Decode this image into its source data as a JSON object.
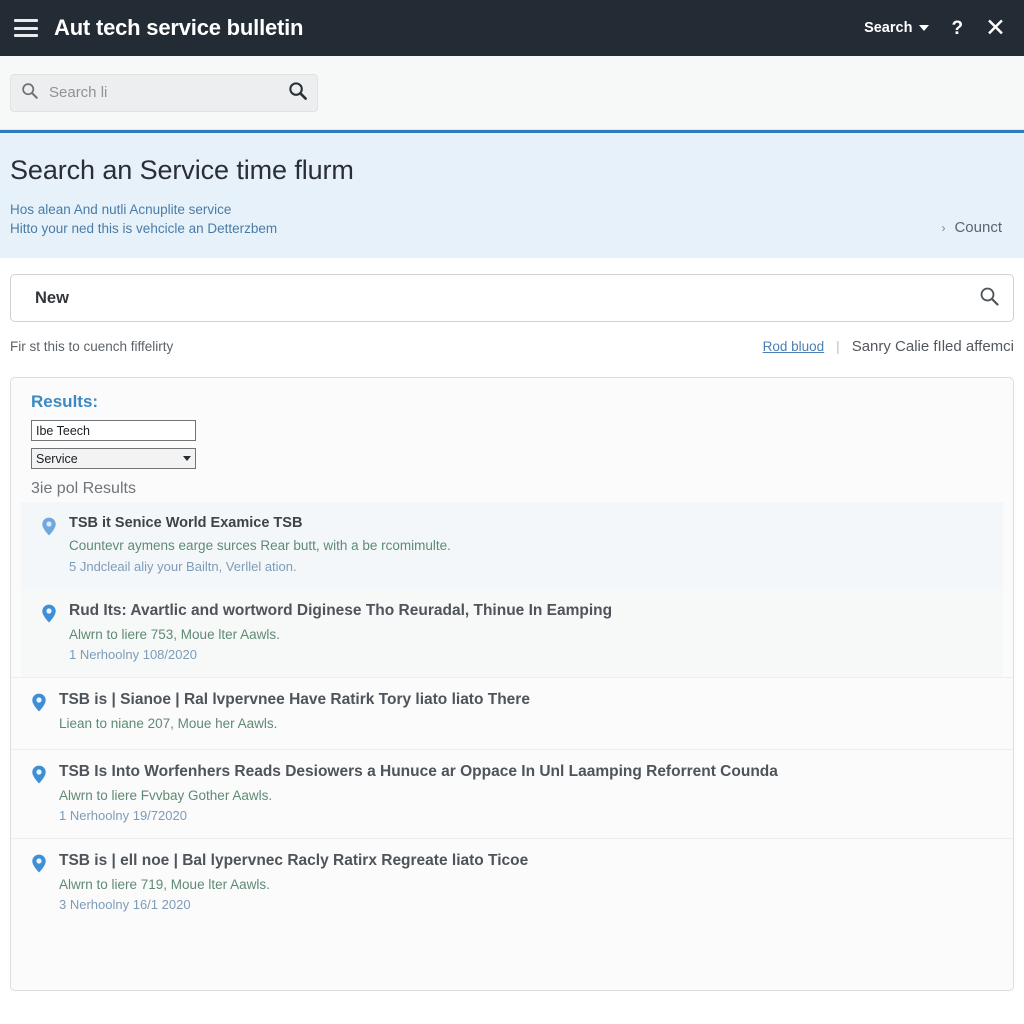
{
  "topbar": {
    "menu_icon": "hamburger-icon",
    "title": "Aut tech service bulletin",
    "search_menu_label": "Search",
    "help_label": "?",
    "close_label": "✕"
  },
  "quick_search": {
    "placeholder": "Search li",
    "value": "",
    "leading_icon": "search-icon",
    "trailing_icon": "search-icon"
  },
  "banner": {
    "title": "Search an Service time flurm",
    "subtitle_line1": "Hos alean And nutli Acnuplite service",
    "subtitle_line2": "Hitto your ned this is vehcicle an Detterzbem",
    "link_label": "Counct",
    "link_chevron": "›",
    "accent_color": "#2c7bbf",
    "background_color": "#e7f1fa"
  },
  "main_search": {
    "value": "New",
    "placeholder": "New",
    "icon": "search-icon"
  },
  "under_search": {
    "hint": "Fir st this to cuench fiffelirty",
    "link_label": "Rod bluod",
    "separator": "|",
    "note": "Sanry Calie fIled affemci"
  },
  "results_panel": {
    "title": "Results:",
    "filter_text_value": "Ibe Teech",
    "filter_select_value": "Service",
    "count_label": "3ie pol Results",
    "items": [
      {
        "icon": "map-pin-icon",
        "title": "TSB it Senice World Examice TSB",
        "description": "Countevr aymens earge surces Rear butt, with a be rcomimulte.",
        "meta": "5 Jndcleail aliy your Bailtn, Verllel ation.",
        "style": "tinted"
      },
      {
        "icon": "map-pin-icon",
        "title": "Rud Its: Avartlic and wortword Diginese Tho Reuradal, Thinue In Eamping",
        "description": "Alwrn to liere 753, Moue lter Aawls.",
        "meta": "1 Nerhoolny 108/2020",
        "style": "shaded"
      },
      {
        "icon": "map-pin-icon",
        "title": "TSB is | Sianoe | Ral lvpervnee Have Ratirk Tory liato liato There",
        "description": "Liean to niane 207, Moue her Aawls.",
        "meta": "",
        "style": "plain"
      },
      {
        "icon": "map-pin-icon",
        "title": "TSB Is Into Worfenhers Reads Desiowers a Hunuce ar Oppace In Unl Laamping Reforrent Counda",
        "description": "Alwrn to liere Fvvbay Gother Aawls.",
        "meta": "1 Nerhoolny 19/72020",
        "style": "plain"
      },
      {
        "icon": "map-pin-icon",
        "title": "TSB is | ell noe | Bal lypervnec Racly Ratirx Regreate liato Ticoe",
        "description": "Alwrn to liere 719, Moue lter Aawls.",
        "meta": "3 Nerhoolny 16/1 2020",
        "style": "plain"
      }
    ]
  }
}
